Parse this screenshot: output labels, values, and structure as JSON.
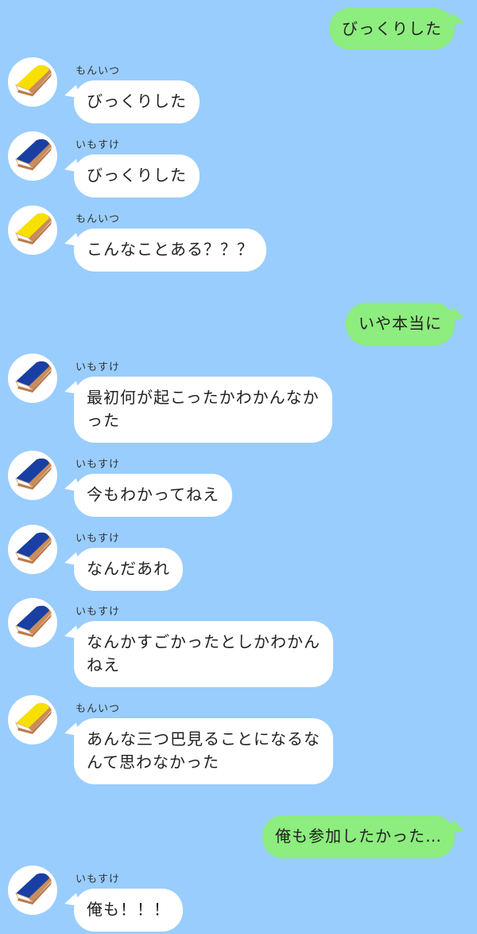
{
  "colors": {
    "background": "#99cdfd",
    "incoming_bubble": "#ffffff",
    "outgoing_bubble": "#8ded7e",
    "avatar_monitsu": "#f7e000",
    "avatar_imosuke": "#1a3fa3"
  },
  "messages": [
    {
      "side": "out",
      "lines": [
        "びっくりした"
      ]
    },
    {
      "side": "in",
      "sender": "もんいつ",
      "avatar": "yellow-bread-icon",
      "lines": [
        "びっくりした"
      ]
    },
    {
      "side": "in",
      "sender": "いもすけ",
      "avatar": "blue-bread-icon",
      "lines": [
        "びっくりした"
      ]
    },
    {
      "side": "in",
      "sender": "もんいつ",
      "avatar": "yellow-bread-icon",
      "lines": [
        "こんなことある？？？"
      ]
    },
    {
      "side": "out",
      "lines": [
        "いや本当に"
      ]
    },
    {
      "side": "in",
      "sender": "いもすけ",
      "avatar": "blue-bread-icon",
      "lines": [
        "最初何が起こったかわかんなか",
        "った"
      ]
    },
    {
      "side": "in",
      "sender": "いもすけ",
      "avatar": "blue-bread-icon",
      "lines": [
        "今もわかってねえ"
      ]
    },
    {
      "side": "in",
      "sender": "いもすけ",
      "avatar": "blue-bread-icon",
      "lines": [
        "なんだあれ"
      ]
    },
    {
      "side": "in",
      "sender": "いもすけ",
      "avatar": "blue-bread-icon",
      "lines": [
        "なんかすごかったとしかわかん",
        "ねえ"
      ]
    },
    {
      "side": "in",
      "sender": "もんいつ",
      "avatar": "yellow-bread-icon",
      "lines": [
        "あんな三つ巴見ることになるな",
        "んて思わなかった"
      ]
    },
    {
      "side": "out",
      "lines": [
        "俺も参加したかった…"
      ]
    },
    {
      "side": "in",
      "sender": "いもすけ",
      "avatar": "blue-bread-icon",
      "lines": [
        "俺も！！！"
      ]
    }
  ]
}
